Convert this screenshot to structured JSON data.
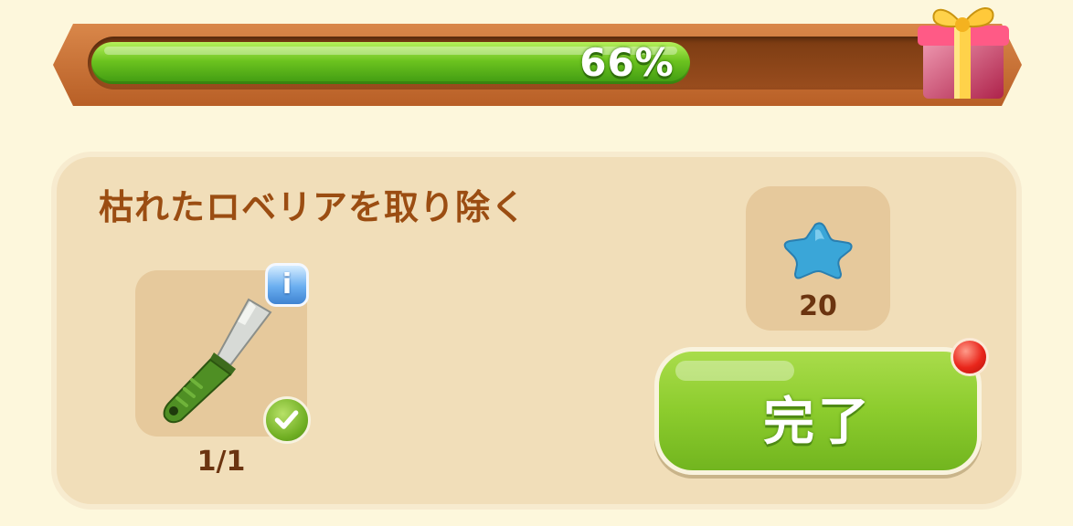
{
  "progress": {
    "percent_label": "66%",
    "fraction": 0.66
  },
  "gift": {
    "icon": "gift-box-icon"
  },
  "task": {
    "title": "枯れたロベリアを取り除く",
    "tool": {
      "icon": "knife-icon",
      "count": "1/1",
      "info_icon": "info-icon",
      "status_icon": "check-icon"
    },
    "reward": {
      "icon": "blue-star-icon",
      "amount": "20"
    },
    "complete_button": {
      "label": "完了"
    },
    "notification_icon": "red-dot-icon"
  },
  "colors": {
    "panel": "#f1deb9",
    "title": "#9b4d12",
    "progress_fill": "#6cc31f",
    "button": "#8ccc2d"
  }
}
